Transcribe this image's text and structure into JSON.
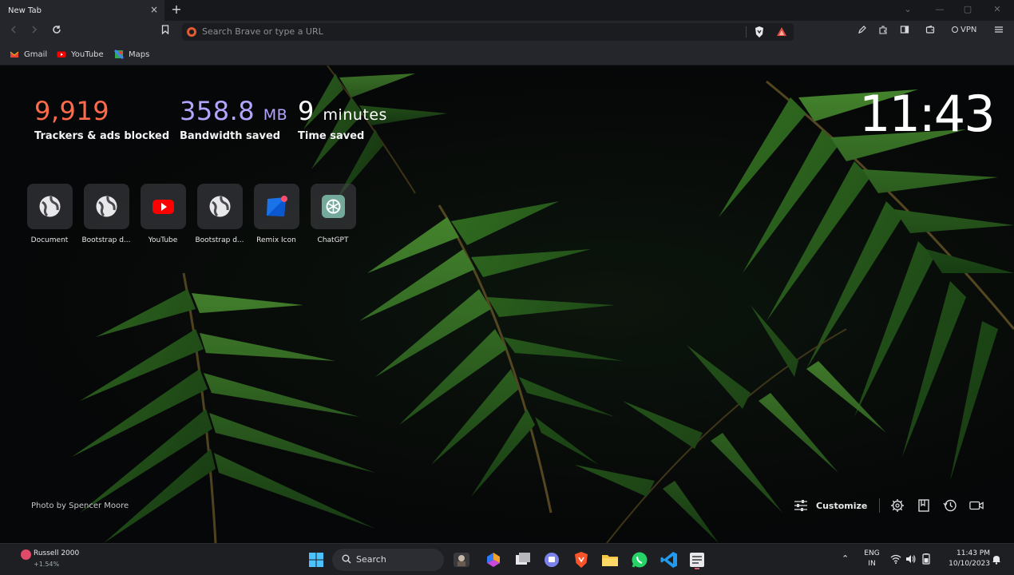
{
  "tab": {
    "title": "New Tab",
    "close": "×",
    "new_tab": "+"
  },
  "omnibox": {
    "placeholder": "Search Brave or type a URL"
  },
  "toolbar": {
    "vpn_label": "VPN"
  },
  "bookmarks": [
    {
      "label": "Gmail",
      "icon": "gmail-icon",
      "color": "#ea4335"
    },
    {
      "label": "YouTube",
      "icon": "youtube-icon",
      "color": "#ff0000"
    },
    {
      "label": "Maps",
      "icon": "maps-icon",
      "color": "#34a853"
    }
  ],
  "stats": {
    "trackers": {
      "value": "9,919",
      "label": "Trackers & ads blocked",
      "color": "#ff6b4a"
    },
    "bandwidth": {
      "value": "358.8",
      "unit": "MB",
      "label": "Bandwidth saved",
      "color": "#b3a4ff"
    },
    "time": {
      "value": "9",
      "unit": "minutes",
      "label": "Time saved",
      "color": "#ffffff"
    }
  },
  "clock": "11:43",
  "top_sites": [
    {
      "label": "Document",
      "icon": "globe-icon"
    },
    {
      "label": "Bootstrap d...",
      "icon": "globe-icon"
    },
    {
      "label": "YouTube",
      "icon": "youtube-icon"
    },
    {
      "label": "Bootstrap d...",
      "icon": "globe-icon"
    },
    {
      "label": "Remix Icon",
      "icon": "remix-icon"
    },
    {
      "label": "ChatGPT",
      "icon": "chatgpt-icon"
    }
  ],
  "photo_credit": "Photo by Spencer Moore",
  "customize_label": "Customize",
  "taskbar": {
    "widget_title": "Russell 2000",
    "widget_sub": "+1.54%",
    "search_label": "Search",
    "lang_top": "ENG",
    "lang_bottom": "IN",
    "time": "11:43 PM",
    "date": "10/10/2023"
  },
  "colors": {
    "accent": "#e05a33",
    "chrome": "#25262b",
    "tabstrip": "#17181c"
  }
}
